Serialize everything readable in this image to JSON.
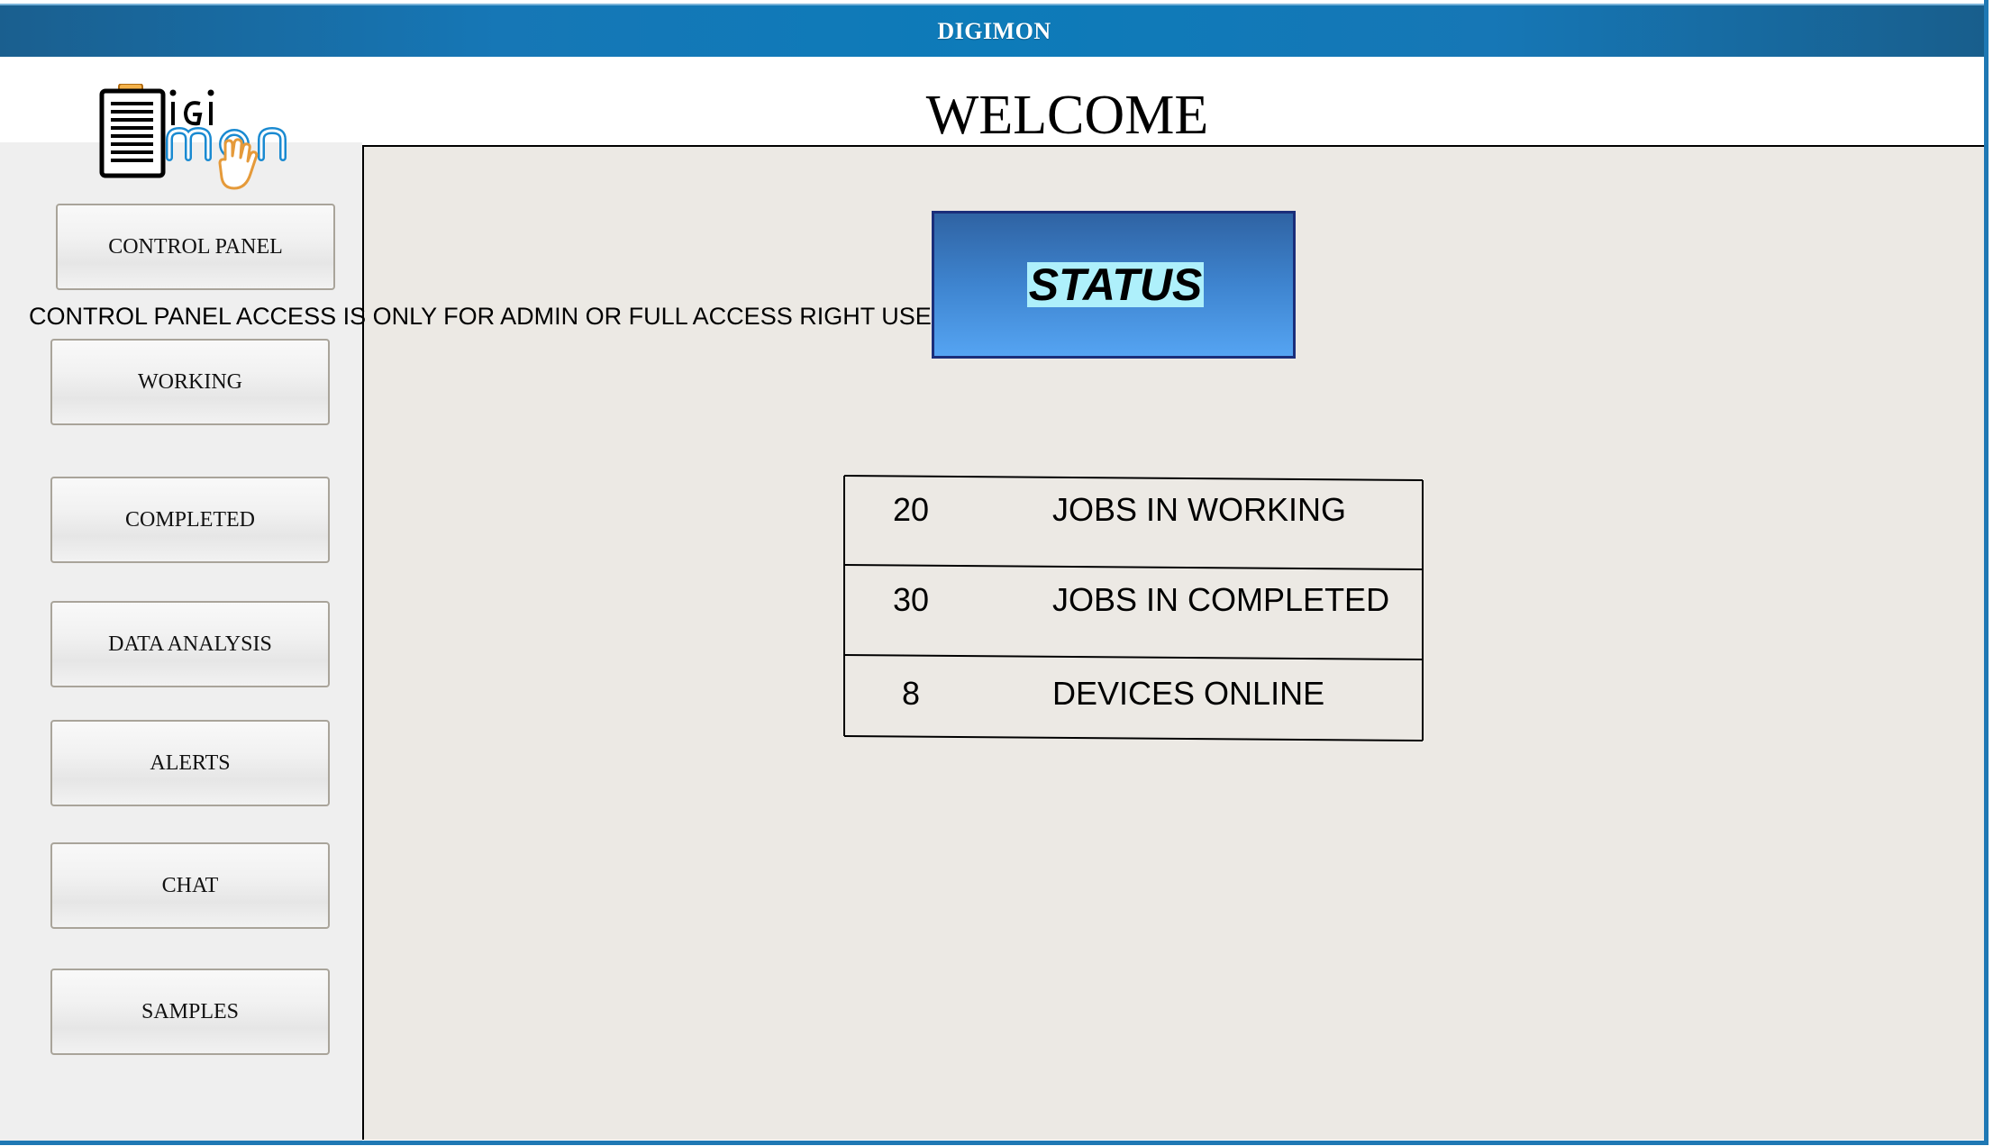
{
  "window": {
    "title": "DIGIMON"
  },
  "header": {
    "welcome": "WELCOME"
  },
  "logo": {
    "alt": "DIGIMON",
    "icon": "clipboard-hand-logo"
  },
  "sidebar": {
    "items": [
      {
        "label": "CONTROL PANEL"
      },
      {
        "label": "WORKING"
      },
      {
        "label": "COMPLETED"
      },
      {
        "label": "DATA ANALYSIS"
      },
      {
        "label": "ALERTS"
      },
      {
        "label": "CHAT"
      },
      {
        "label": "SAMPLES"
      }
    ],
    "access_note": "CONTROL PANEL ACCESS IS ONLY FOR ADMIN OR FULL ACCESS RIGHT USER"
  },
  "main": {
    "status_button": "STATUS",
    "stats": [
      {
        "value": "20",
        "label": "JOBS IN WORKING"
      },
      {
        "value": "30",
        "label": "JOBS IN COMPLETED"
      },
      {
        "value": "8",
        "label": "DEVICES ONLINE"
      }
    ]
  },
  "colors": {
    "titlebar": "#0d7bb9",
    "status_button": "#3e84cf",
    "status_highlight": "#aef0fb",
    "content_bg": "#ece9e4",
    "logo_blue": "#1a8ad1",
    "logo_orange": "#e59a3a"
  }
}
